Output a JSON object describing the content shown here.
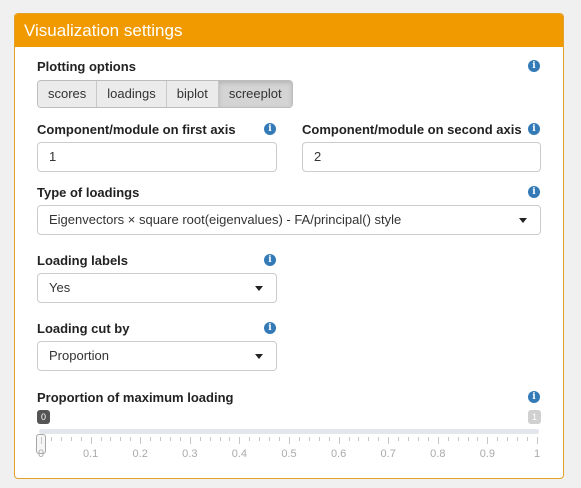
{
  "panel": {
    "title": "Visualization settings",
    "accent_color": "#f09a00"
  },
  "plotting_options": {
    "label": "Plotting options",
    "buttons": [
      "scores",
      "loadings",
      "biplot",
      "screeplot"
    ],
    "active_button": "screeplot"
  },
  "first_axis": {
    "label": "Component/module on first axis",
    "value": "1"
  },
  "second_axis": {
    "label": "Component/module on second axis",
    "value": "2"
  },
  "loadings_type": {
    "label": "Type of loadings",
    "selected": "Eigenvectors × square root(eigenvalues) - FA/principal() style"
  },
  "loading_labels": {
    "label": "Loading labels",
    "selected": "Yes"
  },
  "loading_cut": {
    "label": "Loading cut by",
    "selected": "Proportion"
  },
  "proportion_slider": {
    "label": "Proportion of maximum loading",
    "min_label": "0",
    "max_label": "1",
    "value": 0,
    "min": 0,
    "max": 1,
    "tick_labels": [
      "0",
      "0.1",
      "0.2",
      "0.3",
      "0.4",
      "0.5",
      "0.6",
      "0.7",
      "0.8",
      "0.9",
      "1"
    ]
  },
  "icons": {
    "info": "info-circle-icon",
    "dropdown": "caret-down-icon"
  },
  "info_glyph": "i"
}
